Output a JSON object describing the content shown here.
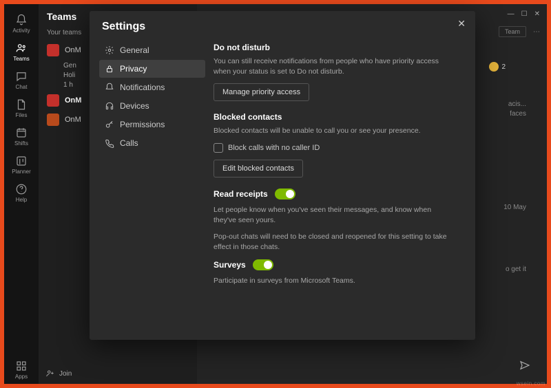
{
  "rail": [
    {
      "label": "Activity"
    },
    {
      "label": "Teams"
    },
    {
      "label": "Chat"
    },
    {
      "label": "Files"
    },
    {
      "label": "Shifts"
    },
    {
      "label": "Planner"
    },
    {
      "label": "Help"
    },
    {
      "label": "Apps"
    }
  ],
  "teams": {
    "header": "Teams",
    "your_teams": "Your teams",
    "rows": [
      {
        "name": "OnM"
      },
      {
        "sub": "Gen"
      },
      {
        "sub": "Holi"
      },
      {
        "sub": "1 h"
      },
      {
        "name": "OnM"
      },
      {
        "name": "OnM"
      }
    ],
    "join": "Join"
  },
  "chat_bg": {
    "team_btn": "Team",
    "snip1": "acis...",
    "snip2": "faces",
    "snip3": "10 May",
    "snip4": "o get it",
    "badge_count": "2"
  },
  "modal": {
    "title": "Settings",
    "nav": [
      {
        "icon": "gear",
        "label": "General"
      },
      {
        "icon": "lock",
        "label": "Privacy"
      },
      {
        "icon": "bell",
        "label": "Notifications"
      },
      {
        "icon": "headphones",
        "label": "Devices"
      },
      {
        "icon": "key",
        "label": "Permissions"
      },
      {
        "icon": "phone",
        "label": "Calls"
      }
    ],
    "dnd": {
      "title": "Do not disturb",
      "desc": "You can still receive notifications from people who have priority access when your status is set to Do not disturb.",
      "btn": "Manage priority access"
    },
    "blocked": {
      "title": "Blocked contacts",
      "desc": "Blocked contacts will be unable to call you or see your presence.",
      "chk": "Block calls with no caller ID",
      "btn": "Edit blocked contacts"
    },
    "read": {
      "title": "Read receipts",
      "desc1": "Let people know when you've seen their messages, and know when they've seen yours.",
      "desc2": "Pop-out chats will need to be closed and reopened for this setting to take effect in those chats."
    },
    "surveys": {
      "title": "Surveys",
      "desc": "Participate in surveys from Microsoft Teams."
    }
  },
  "watermark": "wsein.com"
}
